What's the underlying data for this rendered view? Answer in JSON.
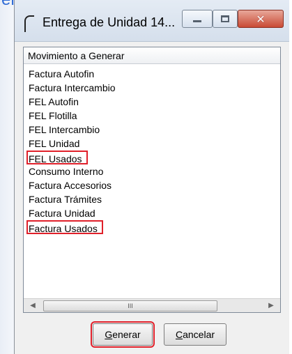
{
  "background": {
    "partial_text": "erar:",
    "accent_color": "#2f6bd6"
  },
  "window": {
    "title": "Entrega de Unidad 14...",
    "controls": {
      "minimize_icon": "minimize-icon",
      "maximize_icon": "maximize-icon",
      "close_icon": "close-icon",
      "close_glyph": "✕"
    }
  },
  "list": {
    "header": "Movimiento a Generar",
    "items": [
      {
        "label": "Factura Autofin",
        "highlighted": false
      },
      {
        "label": "Factura Intercambio",
        "highlighted": false
      },
      {
        "label": "FEL Autofin",
        "highlighted": false
      },
      {
        "label": "FEL Flotilla",
        "highlighted": false
      },
      {
        "label": "FEL Intercambio",
        "highlighted": false
      },
      {
        "label": "FEL Unidad",
        "highlighted": false
      },
      {
        "label": "FEL Usados",
        "highlighted": true
      },
      {
        "label": "Consumo Interno",
        "highlighted": false
      },
      {
        "label": "Factura Accesorios",
        "highlighted": false
      },
      {
        "label": "Factura Trámites",
        "highlighted": false
      },
      {
        "label": "Factura Unidad",
        "highlighted": false
      },
      {
        "label": "Factura Usados",
        "highlighted": true
      }
    ],
    "scrollbar": {
      "left_arrow": "◀",
      "right_arrow": "▶",
      "thumb_grip": "III"
    }
  },
  "buttons": {
    "generar_first": "G",
    "generar_rest": "enerar",
    "cancelar_first": "C",
    "cancelar_rest": "ancelar"
  },
  "highlight_color": "#e0202a"
}
